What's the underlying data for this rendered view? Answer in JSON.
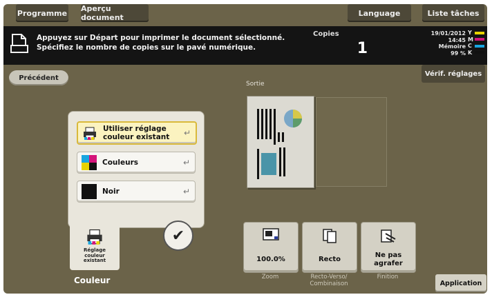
{
  "top_tabs": {
    "programme": "Programme",
    "apercu": "Aperçu document",
    "language": "Language",
    "liste": "Liste tâches"
  },
  "message": {
    "line1": "Appuyez sur Départ pour imprimer le document sélectionné.",
    "line2": "Spécifiez le nombre de copies sur le pavé numérique."
  },
  "copies": {
    "label": "Copies",
    "value": "1"
  },
  "status": {
    "date": "19/01/2012",
    "time": "14:45",
    "memory_label": "Mémoire",
    "memory_value": "99 %",
    "toner_letters": [
      "Y",
      "M",
      "C",
      "K"
    ],
    "toner_colors": [
      "#e8d200",
      "#d4147a",
      "#19a6e0",
      "#111111"
    ]
  },
  "nav": {
    "precedent": "Précédent",
    "verif": "Vérif. réglages"
  },
  "output": {
    "sortie_label": "Sortie"
  },
  "color_options": [
    {
      "label_line1": "Utiliser réglage",
      "label_line2": "couleur existant",
      "selected": true
    },
    {
      "label_line1": "Couleurs",
      "label_line2": "",
      "selected": false
    },
    {
      "label_line1": "Noir",
      "label_line2": "",
      "selected": false
    }
  ],
  "current_mode": {
    "line1": "Réglage",
    "line2": "couleur",
    "line3": "existant",
    "label": "Couleur"
  },
  "functions": {
    "zoom": {
      "value": "100.0%",
      "label": "Zoom"
    },
    "recto": {
      "value": "Recto",
      "label_line1": "Recto-Verso/",
      "label_line2": "Combinaison"
    },
    "finition": {
      "value_line1": "Ne pas",
      "value_line2": "agrafer",
      "label": "Finition"
    }
  },
  "application": "Application",
  "colors": {
    "bg": "#6b6349",
    "selected_border": "#d9b93a"
  }
}
